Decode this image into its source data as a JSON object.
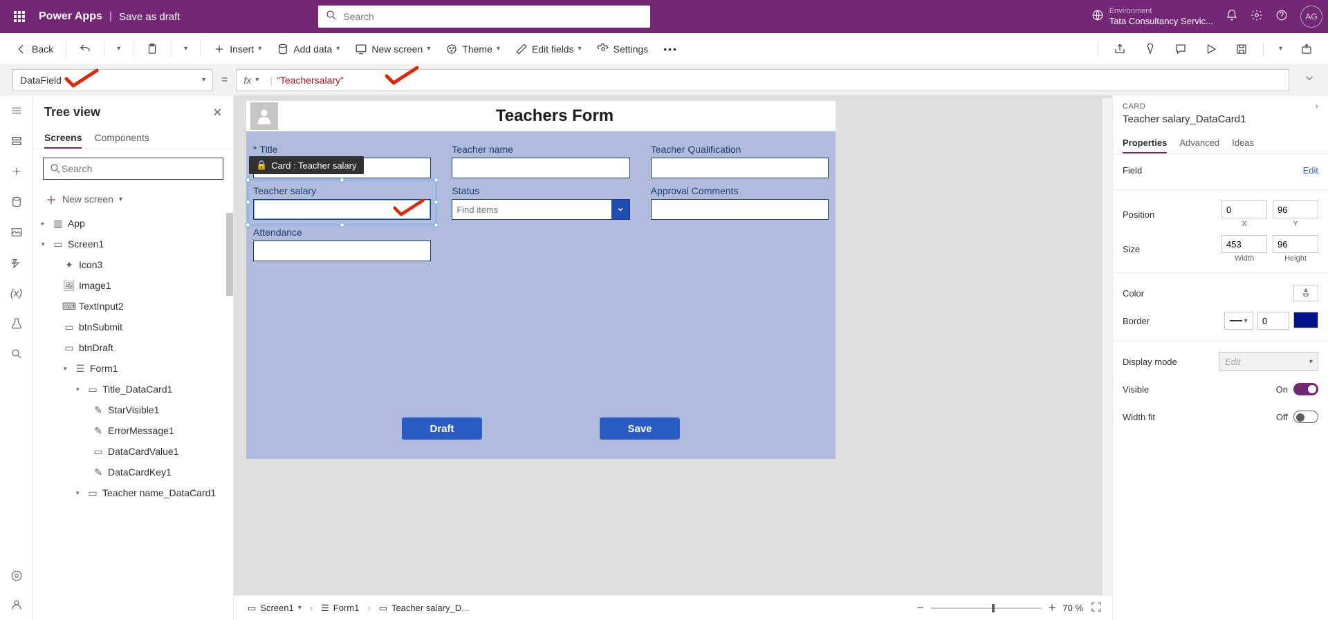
{
  "topbar": {
    "app_title": "Power Apps",
    "subtitle": "Save as draft",
    "search_placeholder": "Search",
    "env_label": "Environment",
    "env_name": "Tata Consultancy Servic...",
    "avatar_initials": "AG"
  },
  "cmdbar": {
    "back": "Back",
    "insert": "Insert",
    "add_data": "Add data",
    "new_screen": "New screen",
    "theme": "Theme",
    "edit_fields": "Edit fields",
    "settings": "Settings"
  },
  "formulabar": {
    "property": "DataField",
    "fx_label": "fx",
    "value": "\"Teachersalary\""
  },
  "tree": {
    "title": "Tree view",
    "tab_screens": "Screens",
    "tab_components": "Components",
    "search_placeholder": "Search",
    "new_screen": "New screen",
    "nodes": {
      "app": "App",
      "screen1": "Screen1",
      "icon3": "Icon3",
      "image1": "Image1",
      "textinput2": "TextInput2",
      "btnsubmit": "btnSubmit",
      "btndraft": "btnDraft",
      "form1": "Form1",
      "title_card": "Title_DataCard1",
      "starvisible": "StarVisible1",
      "errormsg": "ErrorMessage1",
      "dcvalue": "DataCardValue1",
      "dckey": "DataCardKey1",
      "teachername_card": "Teacher name_DataCard1"
    }
  },
  "canvas": {
    "form_title": "Teachers Form",
    "fields": {
      "title": "Title",
      "teacher_name": "Teacher name",
      "teacher_qual": "Teacher Qualification",
      "teacher_salary": "Teacher salary",
      "status": "Status",
      "status_placeholder": "Find items",
      "approval": "Approval Comments",
      "attendance": "Attendance"
    },
    "card_tooltip": "Card : Teacher salary",
    "btn_draft": "Draft",
    "btn_save": "Save"
  },
  "breadcrumb": {
    "screen": "Screen1",
    "form": "Form1",
    "card": "Teacher salary_D..."
  },
  "zoom": {
    "percent": "70",
    "pct_label": "%"
  },
  "props": {
    "type": "CARD",
    "name": "Teacher salary_DataCard1",
    "tab_props": "Properties",
    "tab_adv": "Advanced",
    "tab_ideas": "Ideas",
    "field_label": "Field",
    "edit_link": "Edit",
    "position_label": "Position",
    "pos_x": "0",
    "pos_y": "96",
    "x_lbl": "X",
    "y_lbl": "Y",
    "size_label": "Size",
    "width": "453",
    "height": "96",
    "w_lbl": "Width",
    "h_lbl": "Height",
    "color_label": "Color",
    "border_label": "Border",
    "border_val": "0",
    "display_label": "Display mode",
    "display_val": "Edit",
    "visible_label": "Visible",
    "visible_val": "On",
    "widthfit_label": "Width fit",
    "widthfit_val": "Off"
  }
}
